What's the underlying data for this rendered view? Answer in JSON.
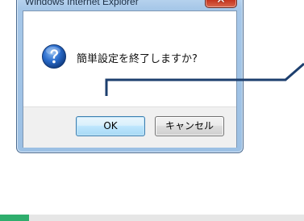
{
  "window": {
    "title": "Windows Internet Explorer",
    "close_label": "✕"
  },
  "dialog": {
    "icon": "question-icon",
    "message": "簡単設定を終了しますか?"
  },
  "buttons": {
    "ok_label": "OK",
    "cancel_label": "キャンセル"
  },
  "colors": {
    "callout_line": "#1d3f6e",
    "band_accent": "#2fae6d",
    "band": "#e6e6e6",
    "question_icon": "#1f5fb5"
  }
}
